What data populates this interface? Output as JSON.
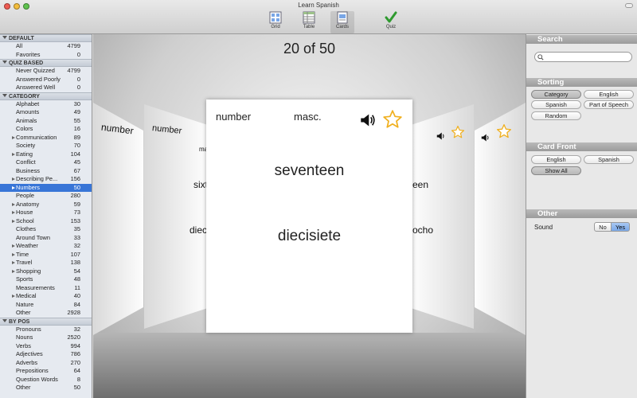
{
  "window": {
    "title": "Learn Spanish"
  },
  "toolbar": {
    "items": [
      {
        "label": "Grid"
      },
      {
        "label": "Table"
      },
      {
        "label": "Cards"
      },
      {
        "label": "Quiz"
      }
    ]
  },
  "sidebar": {
    "sections": [
      {
        "title": "DEFAULT",
        "rows": [
          {
            "label": "All",
            "count": "4799"
          },
          {
            "label": "Favorites",
            "count": "0"
          }
        ]
      },
      {
        "title": "QUIZ BASED",
        "rows": [
          {
            "label": "Never Quizzed",
            "count": "4799"
          },
          {
            "label": "Answered Poorly",
            "count": "0"
          },
          {
            "label": "Answered Well",
            "count": "0"
          }
        ]
      },
      {
        "title": "CATEGORY",
        "rows": [
          {
            "label": "Alphabet",
            "count": "30"
          },
          {
            "label": "Amounts",
            "count": "49"
          },
          {
            "label": "Animals",
            "count": "55"
          },
          {
            "label": "Colors",
            "count": "16"
          },
          {
            "label": "Communication",
            "count": "89"
          },
          {
            "label": "Society",
            "count": "70"
          },
          {
            "label": "Eating",
            "count": "104"
          },
          {
            "label": "Conflict",
            "count": "45"
          },
          {
            "label": "Business",
            "count": "67"
          },
          {
            "label": "Describing Pe...",
            "count": "156"
          },
          {
            "label": "Numbers",
            "count": "50"
          },
          {
            "label": "People",
            "count": "280"
          },
          {
            "label": "Anatomy",
            "count": "59"
          },
          {
            "label": "House",
            "count": "73"
          },
          {
            "label": "School",
            "count": "153"
          },
          {
            "label": "Clothes",
            "count": "35"
          },
          {
            "label": "Around Town",
            "count": "33"
          },
          {
            "label": "Weather",
            "count": "32"
          },
          {
            "label": "Time",
            "count": "107"
          },
          {
            "label": "Travel",
            "count": "138"
          },
          {
            "label": "Shopping",
            "count": "54"
          },
          {
            "label": "Sports",
            "count": "48"
          },
          {
            "label": "Measurements",
            "count": "11"
          },
          {
            "label": "Medical",
            "count": "40"
          },
          {
            "label": "Nature",
            "count": "84"
          },
          {
            "label": "Other",
            "count": "2928"
          }
        ]
      },
      {
        "title": "BY POS",
        "rows": [
          {
            "label": "Pronouns",
            "count": "32"
          },
          {
            "label": "Nouns",
            "count": "2520"
          },
          {
            "label": "Verbs",
            "count": "994"
          },
          {
            "label": "Adjectives",
            "count": "786"
          },
          {
            "label": "Adverbs",
            "count": "270"
          },
          {
            "label": "Prepositions",
            "count": "64"
          },
          {
            "label": "Question Words",
            "count": "8"
          },
          {
            "label": "Other",
            "count": "50"
          }
        ]
      }
    ]
  },
  "stage": {
    "counter": "20 of 50",
    "card": {
      "word_type": "number",
      "gender": "masc.",
      "english": "seventeen",
      "spanish": "diecisiete"
    },
    "left_far": {
      "word_type": "number"
    },
    "left_near": {
      "word_type": "number",
      "gender_fragment": "ma",
      "english_fragment": "sixt",
      "spanish_fragment": "diecis"
    },
    "right_near": {
      "english_fragment": "een",
      "spanish_fragment": "ocho"
    }
  },
  "right_panel": {
    "search": {
      "title": "Search",
      "placeholder": ""
    },
    "sorting": {
      "title": "Sorting",
      "options": [
        "Category",
        "English",
        "Spanish",
        "Part of Speech",
        "Random"
      ]
    },
    "card_front": {
      "title": "Card Front",
      "options": [
        "English",
        "Spanish",
        "Show All"
      ]
    },
    "other": {
      "title": "Other",
      "sound_label": "Sound",
      "no_label": "No",
      "yes_label": "Yes"
    }
  },
  "colors": {
    "selection": "#3875d7",
    "star": "#f0b020",
    "yes_toggle": "#7aa8e8"
  }
}
